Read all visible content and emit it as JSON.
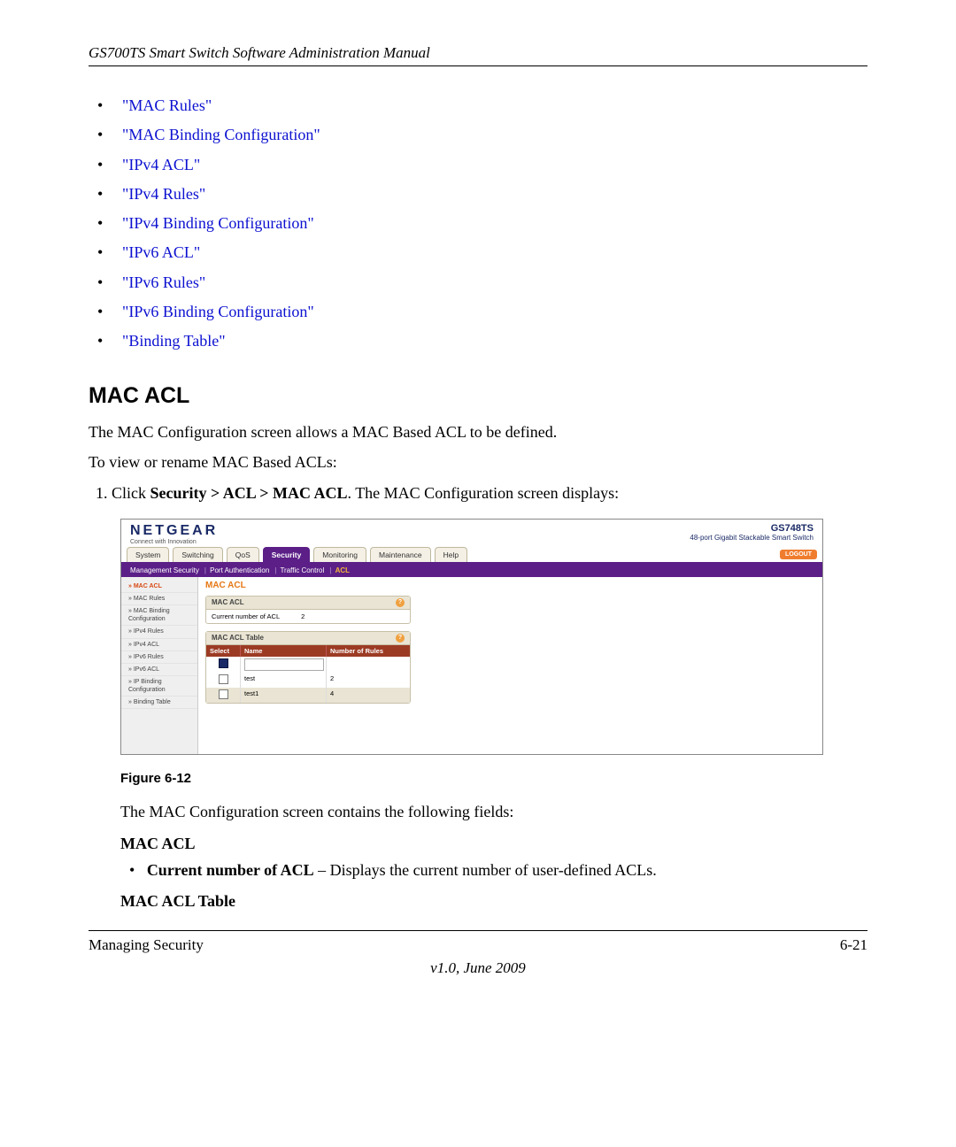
{
  "header": "GS700TS Smart Switch Software Administration Manual",
  "toc": [
    "\"MAC Rules\"",
    "\"MAC Binding Configuration\"",
    "\"IPv4 ACL\"",
    "\"IPv4 Rules\"",
    "\"IPv4 Binding Configuration\"",
    "\"IPv6 ACL\"",
    "\"IPv6 Rules\"",
    "\"IPv6 Binding Configuration\"",
    "\"Binding Table\""
  ],
  "section_heading": "MAC ACL",
  "intro": "The MAC Configuration screen allows a MAC Based ACL to be defined.",
  "instruction": "To view or rename MAC Based ACLs:",
  "step1_prefix": "Click ",
  "step1_bold": "Security > ACL > MAC ACL",
  "step1_suffix": ". The MAC Configuration screen displays:",
  "figure_caption": "Figure 6-12",
  "after_fig": "The MAC Configuration screen contains the following fields:",
  "sub_heading1": "MAC ACL",
  "field1_label": "Current number of ACL",
  "field1_desc": " – Displays the current number of user-defined ACLs.",
  "sub_heading2": "MAC ACL Table",
  "footer_left": "Managing Security",
  "footer_right": "6-21",
  "footer_version": "v1.0, June 2009",
  "shot": {
    "brand": "NETGEAR",
    "brand_sub": "Connect with Innovation",
    "model": "GS748TS",
    "model_desc": "48-port Gigabit Stackable Smart Switch",
    "tabs": [
      "System",
      "Switching",
      "QoS",
      "Security",
      "Monitoring",
      "Maintenance",
      "Help"
    ],
    "active_tab": "Security",
    "logout": "LOGOUT",
    "subbar": {
      "items": [
        "Management Security",
        "Port Authentication",
        "Traffic Control"
      ],
      "active": "ACL"
    },
    "sidenav": [
      "MAC ACL",
      "MAC Rules",
      "MAC Binding Configuration",
      "IPv4 Rules",
      "IPv4 ACL",
      "IPv6 Rules",
      "IPv6 ACL",
      "IP Binding Configuration",
      "Binding Table"
    ],
    "main_title": "MAC ACL",
    "panel1_title": "MAC ACL",
    "panel1_label": "Current number of ACL",
    "panel1_value": "2",
    "panel2_title": "MAC ACL Table",
    "tbl_headers": [
      "Select",
      "Name",
      "Number of Rules"
    ],
    "rows": [
      {
        "name": "test",
        "rules": "2"
      },
      {
        "name": "test1",
        "rules": "4"
      }
    ]
  }
}
